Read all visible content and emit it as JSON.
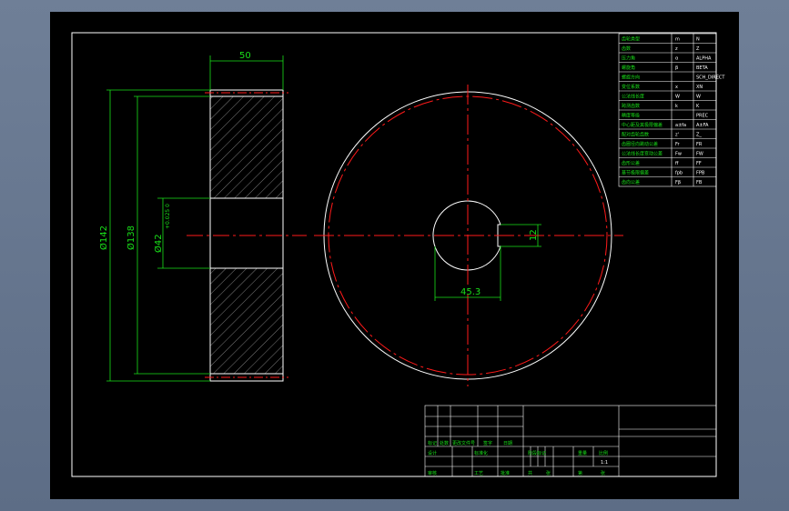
{
  "dimensions": {
    "width_label": "50",
    "outer_dia_label": "Ø142",
    "root_dia_label": "Ø138",
    "bore_dia_label": "Ø42",
    "bore_tol_label": "+0.025\n 0",
    "keyway_width_label": "12",
    "keyway_depth_label": "45.3"
  },
  "param_table": {
    "rows": [
      {
        "name": "齿轮类型",
        "sym": "m",
        "val": "N"
      },
      {
        "name": "齿数",
        "sym": "z",
        "val": "Z"
      },
      {
        "name": "压力角",
        "sym": "α",
        "val": "ALPHA"
      },
      {
        "name": "螺旋角",
        "sym": "β",
        "val": "BETA"
      },
      {
        "name": "螺旋方向",
        "sym": "",
        "val": "SCH_DIRECT"
      },
      {
        "name": "变位系数",
        "sym": "x",
        "val": "XN"
      },
      {
        "name": "公法线长度",
        "sym": "W",
        "val": "W"
      },
      {
        "name": "跨测齿数",
        "sym": "k",
        "val": "K"
      },
      {
        "name": "精度等级",
        "sym": "",
        "val": "PREC"
      },
      {
        "name": "中心距及其极限偏差",
        "sym": "a±fa",
        "val": "A±FA"
      },
      {
        "name": "配对齿轮齿数",
        "sym": "z'",
        "val": "Z_"
      },
      {
        "name": "齿圈径向跳动公差",
        "sym": "Fr",
        "val": "FR"
      },
      {
        "name": "公法线长度变动公差",
        "sym": "Fw",
        "val": "FW"
      },
      {
        "name": "齿形公差",
        "sym": "ff",
        "val": "FF"
      },
      {
        "name": "基节极限偏差",
        "sym": "fpb",
        "val": "FPB"
      },
      {
        "name": "齿向公差",
        "sym": "Fβ",
        "val": "FB"
      }
    ]
  },
  "title_block": {
    "scale": "1:1",
    "labels": [
      "标记",
      "处数",
      "更改文件号",
      "签字",
      "日期",
      "设计",
      "标准化",
      "阶段标记",
      "重量",
      "比例",
      "审核",
      "工艺",
      "批准",
      "共",
      "张",
      "第",
      "张"
    ]
  },
  "colors": {
    "background": "#000000",
    "outline": "#ffffff",
    "dimension": "#19e019",
    "centerline": "#ff1a1a",
    "frame_bg": "#6f7f97"
  }
}
